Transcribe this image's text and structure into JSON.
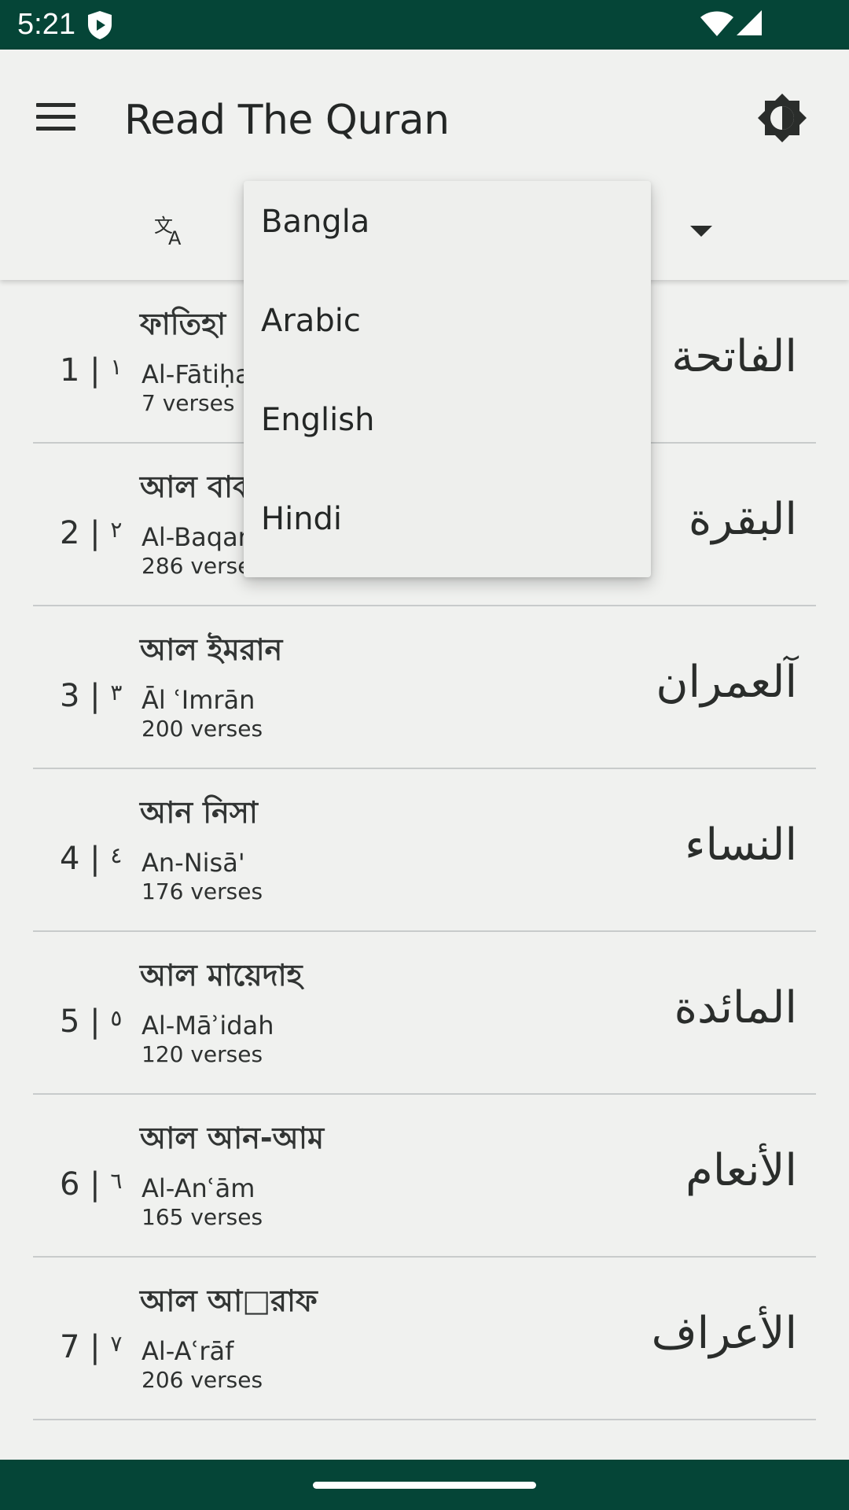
{
  "status_bar": {
    "time": "5:21",
    "icons": [
      "shield-play-icon",
      "wifi-icon",
      "signal-icon"
    ],
    "background": "#054537"
  },
  "app_bar": {
    "title": "Read The Quran",
    "menu_icon": "hamburger-menu-icon",
    "theme_icon": "brightness-icon",
    "translate_icon": "translate-icon",
    "dropdown_icon": "dropdown-arrow-icon"
  },
  "language_menu": {
    "options": [
      "Bangla",
      "Arabic",
      "English",
      "Hindi"
    ]
  },
  "surahs": [
    {
      "number": "1",
      "number_ar": "١",
      "bangla": "ফাতিহা",
      "translit": "Al-Fātiḥah",
      "verses": "7 verses",
      "arabic": "الفاتحة"
    },
    {
      "number": "2",
      "number_ar": "٢",
      "bangla": "আল বাকারা",
      "translit": "Al-Baqarah",
      "verses": "286 verses",
      "arabic": "البقرة"
    },
    {
      "number": "3",
      "number_ar": "٣",
      "bangla": "আল ইমরান",
      "translit": "Āl ʿImrān",
      "verses": "200 verses",
      "arabic": "آلعمران"
    },
    {
      "number": "4",
      "number_ar": "٤",
      "bangla": "আন নিসা",
      "translit": "An-Nisā'",
      "verses": "176 verses",
      "arabic": "النساء"
    },
    {
      "number": "5",
      "number_ar": "٥",
      "bangla": "আল মায়েদাহ",
      "translit": "Al-Māʾidah",
      "verses": "120 verses",
      "arabic": "المائدة"
    },
    {
      "number": "6",
      "number_ar": "٦",
      "bangla": "আল আন-আম",
      "translit": "Al-Anʿām",
      "verses": "165 verses",
      "arabic": "الأنعام"
    },
    {
      "number": "7",
      "number_ar": "٧",
      "bangla": "আল আ□রাফ",
      "translit": "Al-Aʿrāf",
      "verses": "206 verses",
      "arabic": "الأعراف"
    }
  ],
  "colors": {
    "system_bars": "#054537",
    "background": "#f0f1ef",
    "divider": "#c8cbcb"
  }
}
